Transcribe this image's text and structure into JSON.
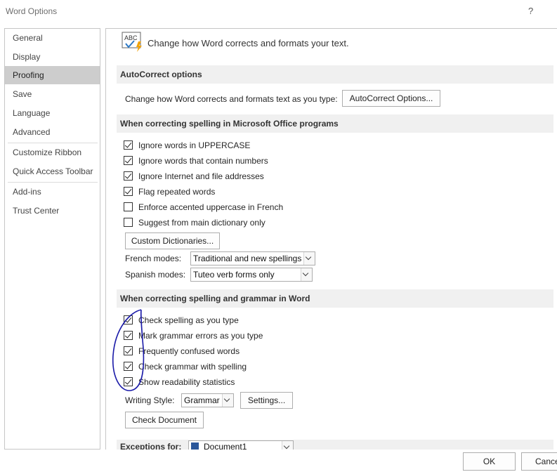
{
  "window": {
    "title": "Word Options",
    "help": "?",
    "close": "✕"
  },
  "sidebar": {
    "items": [
      {
        "label": "General"
      },
      {
        "label": "Display"
      },
      {
        "label": "Proofing"
      },
      {
        "label": "Save"
      },
      {
        "label": "Language"
      },
      {
        "label": "Advanced"
      },
      {
        "label": "Customize Ribbon"
      },
      {
        "label": "Quick Access Toolbar"
      },
      {
        "label": "Add-ins"
      },
      {
        "label": "Trust Center"
      }
    ],
    "selected": "Proofing"
  },
  "main": {
    "intro": "Change how Word corrects and formats your text.",
    "icon_text": "ABC",
    "autocorrect": {
      "header": "AutoCorrect options",
      "description": "Change how Word corrects and formats text as you type:",
      "button": "AutoCorrect Options..."
    },
    "spelling_office": {
      "header": "When correcting spelling in Microsoft Office programs",
      "options": [
        {
          "label": "Ignore words in UPPERCASE",
          "checked": true
        },
        {
          "label": "Ignore words that contain numbers",
          "checked": true
        },
        {
          "label": "Ignore Internet and file addresses",
          "checked": true
        },
        {
          "label": "Flag repeated words",
          "checked": true
        },
        {
          "label": "Enforce accented uppercase in French",
          "checked": false
        },
        {
          "label": "Suggest from main dictionary only",
          "checked": false
        }
      ],
      "custom_dict_button": "Custom Dictionaries...",
      "french_label": "French modes:",
      "french_value": "Traditional and new spellings",
      "spanish_label": "Spanish modes:",
      "spanish_value": "Tuteo verb forms only"
    },
    "spelling_word": {
      "header": "When correcting spelling and grammar in Word",
      "options": [
        {
          "label": "Check spelling as you type",
          "checked": true
        },
        {
          "label": "Mark grammar errors as you type",
          "checked": true
        },
        {
          "label": "Frequently confused words",
          "checked": true
        },
        {
          "label": "Check grammar with spelling",
          "checked": true
        },
        {
          "label": "Show readability statistics",
          "checked": true
        }
      ],
      "writing_style_label": "Writing Style:",
      "writing_style_value": "Grammar",
      "settings_button": "Settings...",
      "check_doc_button": "Check Document"
    },
    "exceptions": {
      "label": "Exceptions for:",
      "document": "Document1"
    }
  },
  "footer": {
    "ok": "OK",
    "cancel": "Cancel"
  },
  "colors": {
    "annotation": "#1a1aa8",
    "selected_nav": "#cdcdcd",
    "section_bg": "#f0f0f0"
  }
}
